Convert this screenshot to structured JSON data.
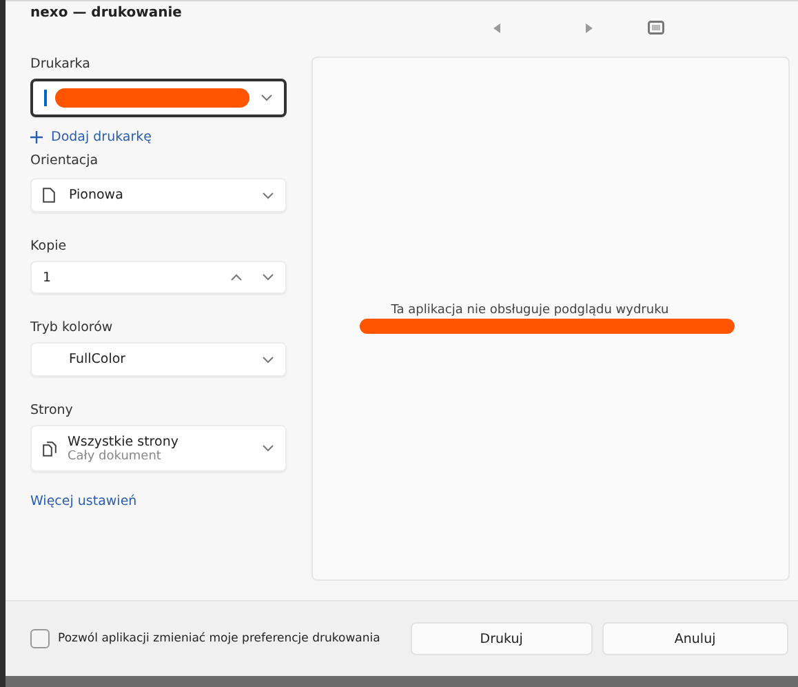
{
  "window": {
    "title": "nexo — drukowanie"
  },
  "printer": {
    "label": "Drukarka",
    "redacted": true
  },
  "add_printer": {
    "label": "Dodaj drukarkę"
  },
  "orientation": {
    "label": "Orientacja",
    "value": "Pionowa"
  },
  "copies": {
    "label": "Kopie",
    "value": "1"
  },
  "color_mode": {
    "label": "Tryb kolorów",
    "value": "FullColor"
  },
  "pages": {
    "label": "Strony",
    "value": "Wszystkie strony",
    "detail": "Cały dokument"
  },
  "more_settings": {
    "label": "Więcej ustawień"
  },
  "preview": {
    "message": "Ta aplikacja nie obsługuje podglądu wydruku",
    "redacted": true
  },
  "footer": {
    "checkbox": {
      "label": "Pozwól aplikacji zmieniać moje preferencje drukowania",
      "checked": false
    },
    "buttons": [
      "Drukuj",
      "Anuluj"
    ]
  }
}
